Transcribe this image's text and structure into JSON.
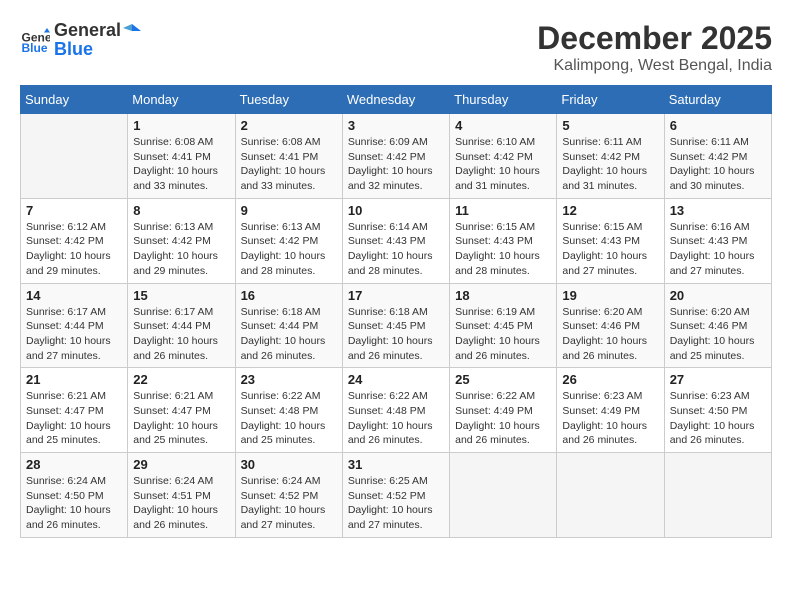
{
  "header": {
    "logo_line1": "General",
    "logo_line2": "Blue",
    "month": "December 2025",
    "location": "Kalimpong, West Bengal, India"
  },
  "days_of_week": [
    "Sunday",
    "Monday",
    "Tuesday",
    "Wednesday",
    "Thursday",
    "Friday",
    "Saturday"
  ],
  "weeks": [
    [
      {
        "day": "",
        "data": ""
      },
      {
        "day": "1",
        "data": "Sunrise: 6:08 AM\nSunset: 4:41 PM\nDaylight: 10 hours\nand 33 minutes."
      },
      {
        "day": "2",
        "data": "Sunrise: 6:08 AM\nSunset: 4:41 PM\nDaylight: 10 hours\nand 33 minutes."
      },
      {
        "day": "3",
        "data": "Sunrise: 6:09 AM\nSunset: 4:42 PM\nDaylight: 10 hours\nand 32 minutes."
      },
      {
        "day": "4",
        "data": "Sunrise: 6:10 AM\nSunset: 4:42 PM\nDaylight: 10 hours\nand 31 minutes."
      },
      {
        "day": "5",
        "data": "Sunrise: 6:11 AM\nSunset: 4:42 PM\nDaylight: 10 hours\nand 31 minutes."
      },
      {
        "day": "6",
        "data": "Sunrise: 6:11 AM\nSunset: 4:42 PM\nDaylight: 10 hours\nand 30 minutes."
      }
    ],
    [
      {
        "day": "7",
        "data": "Sunrise: 6:12 AM\nSunset: 4:42 PM\nDaylight: 10 hours\nand 29 minutes."
      },
      {
        "day": "8",
        "data": "Sunrise: 6:13 AM\nSunset: 4:42 PM\nDaylight: 10 hours\nand 29 minutes."
      },
      {
        "day": "9",
        "data": "Sunrise: 6:13 AM\nSunset: 4:42 PM\nDaylight: 10 hours\nand 28 minutes."
      },
      {
        "day": "10",
        "data": "Sunrise: 6:14 AM\nSunset: 4:43 PM\nDaylight: 10 hours\nand 28 minutes."
      },
      {
        "day": "11",
        "data": "Sunrise: 6:15 AM\nSunset: 4:43 PM\nDaylight: 10 hours\nand 28 minutes."
      },
      {
        "day": "12",
        "data": "Sunrise: 6:15 AM\nSunset: 4:43 PM\nDaylight: 10 hours\nand 27 minutes."
      },
      {
        "day": "13",
        "data": "Sunrise: 6:16 AM\nSunset: 4:43 PM\nDaylight: 10 hours\nand 27 minutes."
      }
    ],
    [
      {
        "day": "14",
        "data": "Sunrise: 6:17 AM\nSunset: 4:44 PM\nDaylight: 10 hours\nand 27 minutes."
      },
      {
        "day": "15",
        "data": "Sunrise: 6:17 AM\nSunset: 4:44 PM\nDaylight: 10 hours\nand 26 minutes."
      },
      {
        "day": "16",
        "data": "Sunrise: 6:18 AM\nSunset: 4:44 PM\nDaylight: 10 hours\nand 26 minutes."
      },
      {
        "day": "17",
        "data": "Sunrise: 6:18 AM\nSunset: 4:45 PM\nDaylight: 10 hours\nand 26 minutes."
      },
      {
        "day": "18",
        "data": "Sunrise: 6:19 AM\nSunset: 4:45 PM\nDaylight: 10 hours\nand 26 minutes."
      },
      {
        "day": "19",
        "data": "Sunrise: 6:20 AM\nSunset: 4:46 PM\nDaylight: 10 hours\nand 26 minutes."
      },
      {
        "day": "20",
        "data": "Sunrise: 6:20 AM\nSunset: 4:46 PM\nDaylight: 10 hours\nand 25 minutes."
      }
    ],
    [
      {
        "day": "21",
        "data": "Sunrise: 6:21 AM\nSunset: 4:47 PM\nDaylight: 10 hours\nand 25 minutes."
      },
      {
        "day": "22",
        "data": "Sunrise: 6:21 AM\nSunset: 4:47 PM\nDaylight: 10 hours\nand 25 minutes."
      },
      {
        "day": "23",
        "data": "Sunrise: 6:22 AM\nSunset: 4:48 PM\nDaylight: 10 hours\nand 25 minutes."
      },
      {
        "day": "24",
        "data": "Sunrise: 6:22 AM\nSunset: 4:48 PM\nDaylight: 10 hours\nand 26 minutes."
      },
      {
        "day": "25",
        "data": "Sunrise: 6:22 AM\nSunset: 4:49 PM\nDaylight: 10 hours\nand 26 minutes."
      },
      {
        "day": "26",
        "data": "Sunrise: 6:23 AM\nSunset: 4:49 PM\nDaylight: 10 hours\nand 26 minutes."
      },
      {
        "day": "27",
        "data": "Sunrise: 6:23 AM\nSunset: 4:50 PM\nDaylight: 10 hours\nand 26 minutes."
      }
    ],
    [
      {
        "day": "28",
        "data": "Sunrise: 6:24 AM\nSunset: 4:50 PM\nDaylight: 10 hours\nand 26 minutes."
      },
      {
        "day": "29",
        "data": "Sunrise: 6:24 AM\nSunset: 4:51 PM\nDaylight: 10 hours\nand 26 minutes."
      },
      {
        "day": "30",
        "data": "Sunrise: 6:24 AM\nSunset: 4:52 PM\nDaylight: 10 hours\nand 27 minutes."
      },
      {
        "day": "31",
        "data": "Sunrise: 6:25 AM\nSunset: 4:52 PM\nDaylight: 10 hours\nand 27 minutes."
      },
      {
        "day": "",
        "data": ""
      },
      {
        "day": "",
        "data": ""
      },
      {
        "day": "",
        "data": ""
      }
    ]
  ]
}
